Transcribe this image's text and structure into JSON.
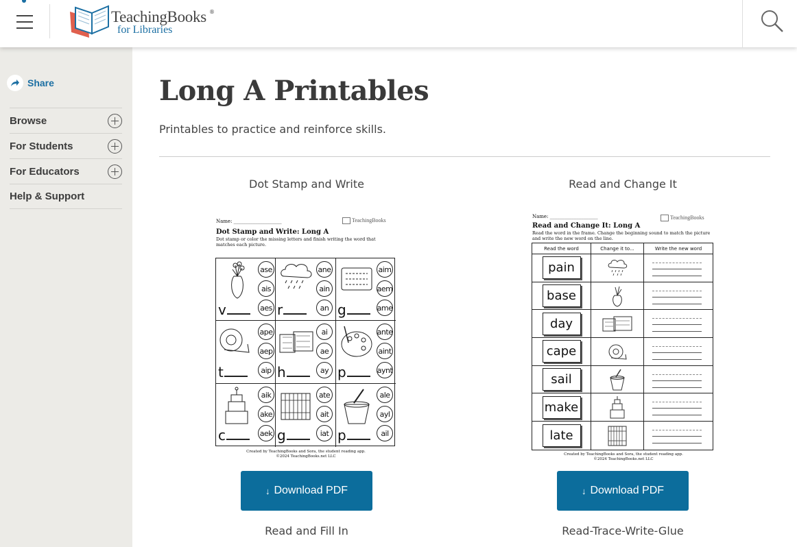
{
  "header": {
    "logo_line1": "TeachingBooks",
    "logo_reg": "®",
    "logo_line2": "for Libraries"
  },
  "sidebar": {
    "share_label": "Share",
    "items": [
      {
        "label": "Browse",
        "expandable": true
      },
      {
        "label": "For Students",
        "expandable": true
      },
      {
        "label": "For Educators",
        "expandable": true
      },
      {
        "label": "Help & Support",
        "expandable": false
      }
    ]
  },
  "main": {
    "title": "Long A Printables",
    "subtitle": "Printables to practice and reinforce skills.",
    "cards": [
      {
        "title": "Dot Stamp and Write",
        "button": "Download PDF",
        "button_icon": "↓"
      },
      {
        "title": "Read and Change It",
        "button": "Download PDF",
        "button_icon": "↓"
      },
      {
        "title": "Read and Fill In"
      },
      {
        "title": "Read-Trace-Write-Glue"
      }
    ]
  },
  "sheet1": {
    "name_label": "Name: ____________________",
    "logo": "TeachingBooks",
    "heading": "Dot Stamp and Write: Long A",
    "instructions": "Dot stamp or color the missing letters and finish writing the word that matches each picture.",
    "cells": [
      {
        "start": "v",
        "options": [
          "ase",
          "ais",
          "aes"
        ]
      },
      {
        "start": "r",
        "options": [
          "ane",
          "ain",
          "an"
        ]
      },
      {
        "start": "g",
        "options": [
          "aim",
          "aem",
          "ame"
        ]
      },
      {
        "start": "t",
        "options": [
          "ape",
          "aep",
          "aip"
        ]
      },
      {
        "start": "h",
        "options": [
          "ai",
          "ae",
          "ay"
        ]
      },
      {
        "start": "p",
        "options": [
          "ante",
          "aint",
          "aynt"
        ]
      },
      {
        "start": "c",
        "options": [
          "aik",
          "ake",
          "aek"
        ]
      },
      {
        "start": "g",
        "options": [
          "ate",
          "ait",
          "iat"
        ]
      },
      {
        "start": "p",
        "options": [
          "ale",
          "ayl",
          "ail"
        ]
      }
    ],
    "footer_1": "Created by TeachingBooks and Sora, the student reading app.",
    "footer_2": "©2024 TeachingBooks.net LLC"
  },
  "sheet2": {
    "name_label": "Name: ____________________",
    "logo": "TeachingBooks",
    "heading": "Read and Change It: Long A",
    "instructions": "Read the word in the frame. Change the beginning sound to match the picture and write the new word on the line.",
    "col_headers": [
      "Read the word",
      "Change it to...",
      "Write the new word"
    ],
    "words": [
      "pain",
      "base",
      "day",
      "cape",
      "sail",
      "make",
      "late"
    ],
    "footer_1": "Created by TeachingBooks and Sora, the student reading app.",
    "footer_2": "©2024 TeachingBooks.net LLC"
  }
}
